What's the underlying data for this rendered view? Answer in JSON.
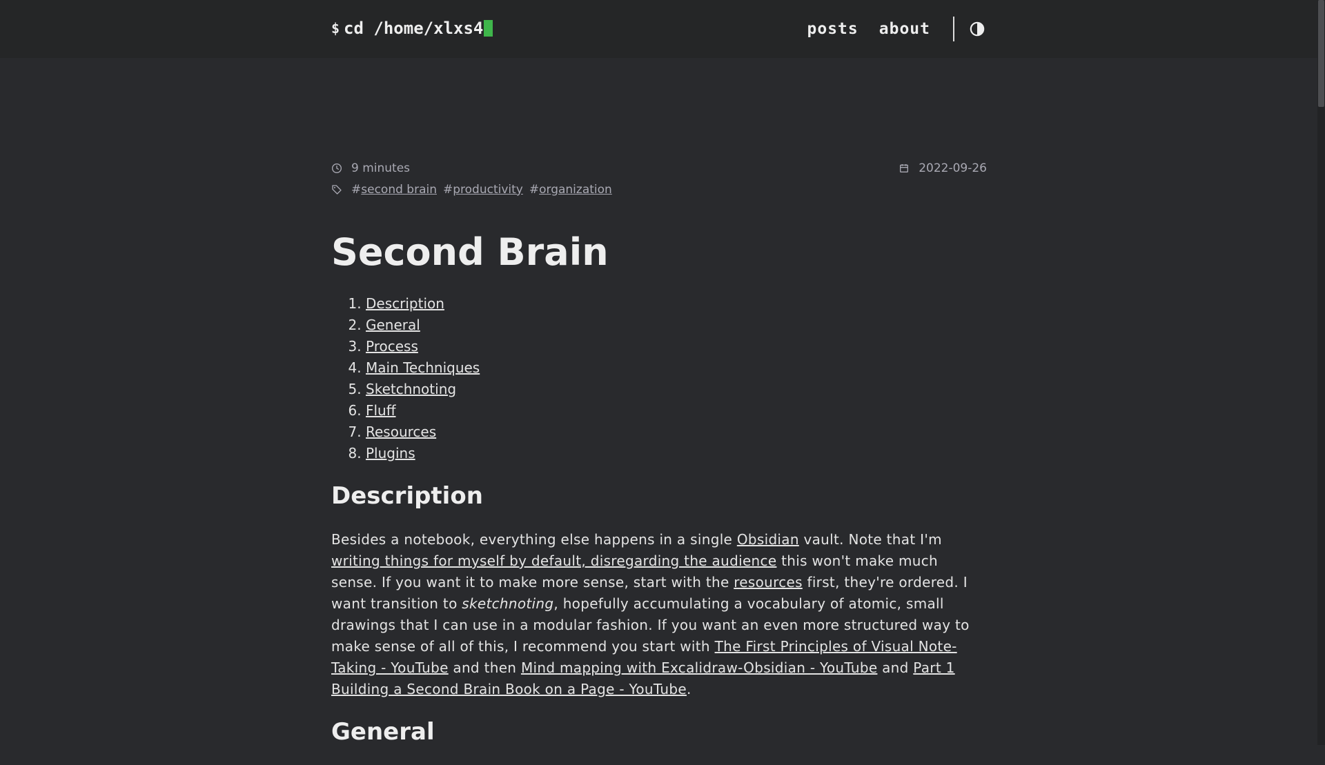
{
  "header": {
    "prompt_symbol": "$",
    "logo_text": "cd /home/xlxs4",
    "nav": [
      {
        "label": "posts"
      },
      {
        "label": "about"
      }
    ],
    "theme_toggle_icon": "contrast-icon",
    "cursor_color": "#3fb64b"
  },
  "post": {
    "reading_time": "9 minutes",
    "date": "2022-09-26",
    "tags": [
      {
        "hash": "#",
        "label": "second brain"
      },
      {
        "hash": "#",
        "label": "productivity"
      },
      {
        "hash": "#",
        "label": "organization"
      }
    ],
    "title": "Second Brain",
    "toc": [
      "Description",
      "General",
      "Process",
      "Main Techniques",
      "Sketchnoting",
      "Fluff",
      "Resources",
      "Plugins"
    ],
    "description_heading": "Description",
    "description": {
      "t1": "Besides a notebook, everything else happens in a single ",
      "l1": "Obsidian",
      "t2": " vault. Note that I'm ",
      "l2": "writing things for myself by default, disregarding the audience",
      "t3": " this won't make much sense. If you want it to make more sense, start with the ",
      "l3": "resources",
      "t4": " first, they're ordered. I want transition to ",
      "em": "sketchnoting",
      "t5": ", hopefully accumulating a vocabulary of atomic, small drawings that I can use in a modular fashion. If you want an even more structured way to make sense of all of this, I recommend you start with ",
      "l4": "The First Principles of Visual Note-Taking - YouTube",
      "t6": " and then ",
      "l5": "Mind mapping with Excalidraw-Obsidian - YouTube",
      "t7": " and ",
      "l6": "Part 1 Building a Second Brain Book on a Page - YouTube",
      "t8": "."
    },
    "general_heading": "General"
  }
}
